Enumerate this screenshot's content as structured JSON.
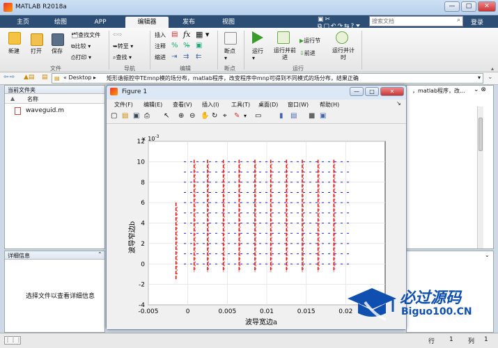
{
  "window": {
    "title": "MATLAB R2018a",
    "minimize": "—",
    "maximize": "□",
    "close": "✕"
  },
  "tabs": [
    "主页",
    "绘图",
    "APP",
    "编辑器",
    "发布",
    "视图"
  ],
  "search": {
    "placeholder": "搜索文档"
  },
  "login": "登录",
  "ribbon": {
    "file": {
      "new": "新建",
      "open": "打开",
      "save": "保存",
      "find_files": "查找文件",
      "compare": "比较",
      "print": "打印",
      "section": "文件"
    },
    "navigate": {
      "goto": "转至",
      "find": "查找",
      "section": "导航"
    },
    "edit": {
      "insert": "插入",
      "comment": "注释",
      "indent": "缩进",
      "section": "编辑"
    },
    "breakpoints": {
      "label": "断点",
      "section": "断点"
    },
    "run": {
      "run": "运行",
      "run_advance": "运行并前进",
      "run_section": "运行节",
      "advance": "前进",
      "run_time": "运行并计时",
      "section": "运行"
    }
  },
  "address": {
    "root": "«  Desktop  ▸",
    "path": "矩形谐振腔中TEmnp模的场分布，matlab程序，改变程序中mnp可得到不同模式的场分布，结果正确",
    "path_right": "，matlab程序，改..."
  },
  "current_folder": {
    "title": "当前文件夹",
    "col_name": "名称",
    "sort": "▲",
    "file": "waveguid.m"
  },
  "details": {
    "title": "详细信息",
    "hint": "选择文件以查看详细信息"
  },
  "status": {
    "row_label": "行",
    "row": "1",
    "col_label": "列",
    "col": "1"
  },
  "figure": {
    "title": "Figure 1",
    "menu": [
      "文件(F)",
      "编辑(E)",
      "查看(V)",
      "插入(I)",
      "工具(T)",
      "桌面(D)",
      "窗口(W)",
      "帮助(H)"
    ]
  },
  "watermark": {
    "brand": "必过源码",
    "site": "Biguo100.CN"
  },
  "chart_data": {
    "type": "scatter",
    "xlabel": "波导宽边a",
    "ylabel": "波导窄边b",
    "exponent_label": "× 10",
    "exponent": "-3",
    "xlim": [
      -0.005,
      0.025
    ],
    "ylim": [
      -0.004,
      0.012
    ],
    "xticks": [
      "-0.005",
      "0",
      "0.005",
      "0.01",
      "0.015",
      "0.02"
    ],
    "yticks": [
      "-4",
      "-2",
      "0",
      "2",
      "4",
      "6",
      "8",
      "10",
      "12"
    ],
    "grid": true,
    "series": [
      {
        "style": "red dashed vertical field lines",
        "color": "#e01010",
        "x": [
          -0.0015,
          0.0008,
          0.0025,
          0.0045,
          0.0065,
          0.0085,
          0.0105,
          0.0125,
          0.0145,
          0.0165,
          0.0185
        ]
      },
      {
        "style": "blue dashes",
        "color": "#2020e0",
        "y": [
          0,
          0.001,
          0.002,
          0.003,
          0.004,
          0.005,
          0.006,
          0.007,
          0.008,
          0.009,
          0.01
        ]
      }
    ]
  },
  "colors": {
    "tab_bar": "#2c4d74",
    "red_series": "#e01010",
    "blue_series": "#2020e0",
    "watermark_blue": "#0f4fb0"
  }
}
